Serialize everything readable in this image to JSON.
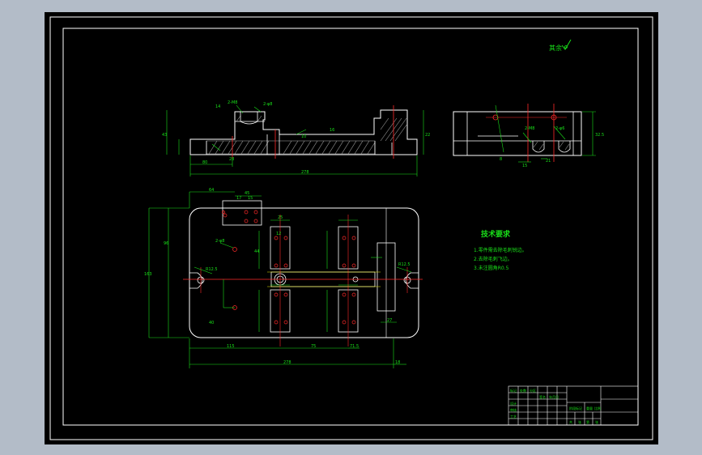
{
  "colors": {
    "background": "#b3bcc8",
    "paper": "#000000",
    "frame": "#ffffff",
    "green": "#19e019",
    "red": "#ff2a2a",
    "yellow": "#e8e800",
    "hatch": "#b0b0b0"
  },
  "roughness_note": "其余",
  "tech_requirements": {
    "title": "技术要求",
    "items": [
      "1.零件需去除毛刺锐边。",
      "2.去除毛刺飞边。",
      "3.未注圆角R0.5"
    ]
  },
  "front_view": {
    "overall_length": "278",
    "base_length": "80",
    "small_dim": "28",
    "left_height": "43",
    "label_14": "14",
    "label_10": "10",
    "label_16": "16",
    "label_22": "22",
    "hole_note_left": "2-M8",
    "hole_note_right": "2-φ8"
  },
  "side_view": {
    "height_dim": "32.5",
    "hole_note_a": "2-M8",
    "hole_note_b": "2-φ6",
    "bottom_dim_a": "8",
    "bottom_dim_b": "15",
    "bottom_dim_c": "21"
  },
  "top_view": {
    "overall_length": "278",
    "overall_height": "163",
    "inner_height": "96",
    "dim_64": "64",
    "dim_45": "45",
    "dim_17": "17",
    "dim_15": "15",
    "dim_12": "12",
    "dim_25": "25",
    "dim_44": "44",
    "dim_115": "115",
    "dim_75": "75",
    "dim_71_5": "71.5",
    "dim_18": "18",
    "dim_27": "27",
    "dim_40": "40",
    "hole_note": "2-φ8",
    "slot_note_left": "R12.5",
    "slot_note_right": "R12.5"
  },
  "title_block": {
    "rows": [
      "标记",
      "处数",
      "分区",
      "设计",
      "审核",
      "工艺"
    ],
    "cols": [
      "签名",
      "年月日",
      "阶段标记",
      "重量",
      "比例"
    ],
    "bottom": [
      "共",
      "张",
      "第",
      "张"
    ]
  }
}
